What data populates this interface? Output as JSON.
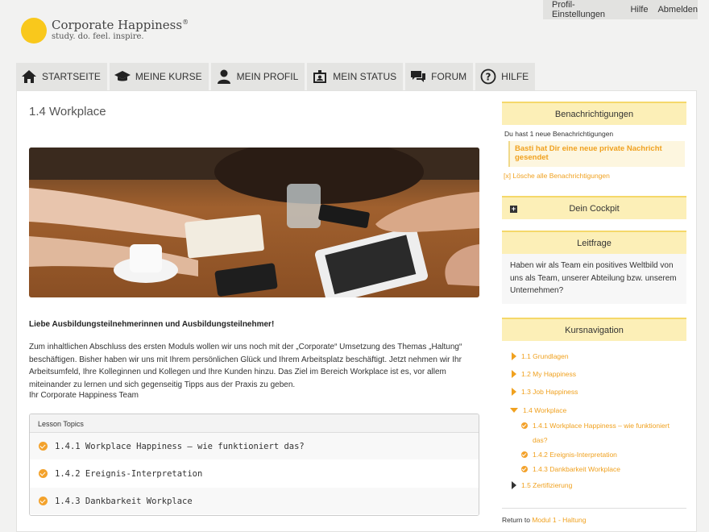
{
  "topbar": {
    "profile": "Profil-Einstellungen",
    "help": "Hilfe",
    "logout": "Abmelden"
  },
  "logo": {
    "title": "Corporate Happiness",
    "reg": "®",
    "subtitle": "study. do. feel. inspire."
  },
  "nav": [
    {
      "label": "STARTSEITE",
      "icon": "home-icon"
    },
    {
      "label": "MEINE KURSE",
      "icon": "graduation-cap-icon"
    },
    {
      "label": "MEIN PROFIL",
      "icon": "user-icon"
    },
    {
      "label": "MEIN STATUS",
      "icon": "id-badge-icon"
    },
    {
      "label": "FORUM",
      "icon": "chat-icon"
    },
    {
      "label": "HILFE",
      "icon": "question-icon"
    }
  ],
  "main": {
    "title": "1.4 Workplace",
    "intro_head": "Liebe Ausbildungsteilnehmerinnen und Ausbildungsteilnehmer!",
    "intro_body": "Zum inhaltlichen Abschluss des ersten Moduls wollen wir uns noch mit der „Corporate“ Umsetzung des Themas „Haltung“ beschäftigen. Bisher haben wir uns mit Ihrem persönlichen Glück und Ihrem Arbeitsplatz beschäftigt. Jetzt nehmen wir Ihr Arbeitsumfeld, Ihre Kolleginnen und Kollegen und Ihre Kunden hinzu. Das Ziel im Bereich Workplace ist es, vor allem miteinander zu lernen und sich gegenseitig Tipps aus der Praxis zu geben.",
    "intro_sign": "Ihr Corporate Happiness Team",
    "lesson_topics_title": "Lesson Topics",
    "lessons": [
      "1.4.1 Workplace Happiness – wie funktioniert das?",
      "1.4.2 Ereignis-Interpretation",
      "1.4.3 Dankbarkeit Workplace"
    ]
  },
  "sidebar": {
    "notifications": {
      "title": "Benachrichtigungen",
      "count_text": "Du hast 1 neue Benachrichtigungen",
      "card": "Basti hat Dir eine neue private Nachricht gesendet",
      "clear_prefix": "[x]",
      "clear": "Lösche alle Benachrichtigungen"
    },
    "cockpit": {
      "title": "Dein Cockpit"
    },
    "leitfrage": {
      "title": "Leitfrage",
      "text": "Haben wir als Team ein positives Weltbild von uns als Team, unserer Abteilung bzw. unserem Unternehmen?"
    },
    "kursnavigation": {
      "title": "Kursnavigation",
      "items": [
        "1.1 Grundlagen",
        "1.2 My Happiness",
        "1.3 Job Happiness",
        "1.4 Workplace",
        "1.5 Zertifizierung"
      ],
      "subitems": [
        "1.4.1 Workplace Happiness – wie funktioniert",
        "das?",
        "1.4.2 Ereignis-Interpretation",
        "1.4.3 Dankbarkeit Workplace"
      ],
      "return_prefix": "Return to",
      "return_link": "Modul 1 - Haltung"
    }
  },
  "colors": {
    "accent": "#f0a11f",
    "logo": "#f9c81c",
    "sidebar_head": "#fcefb7"
  }
}
